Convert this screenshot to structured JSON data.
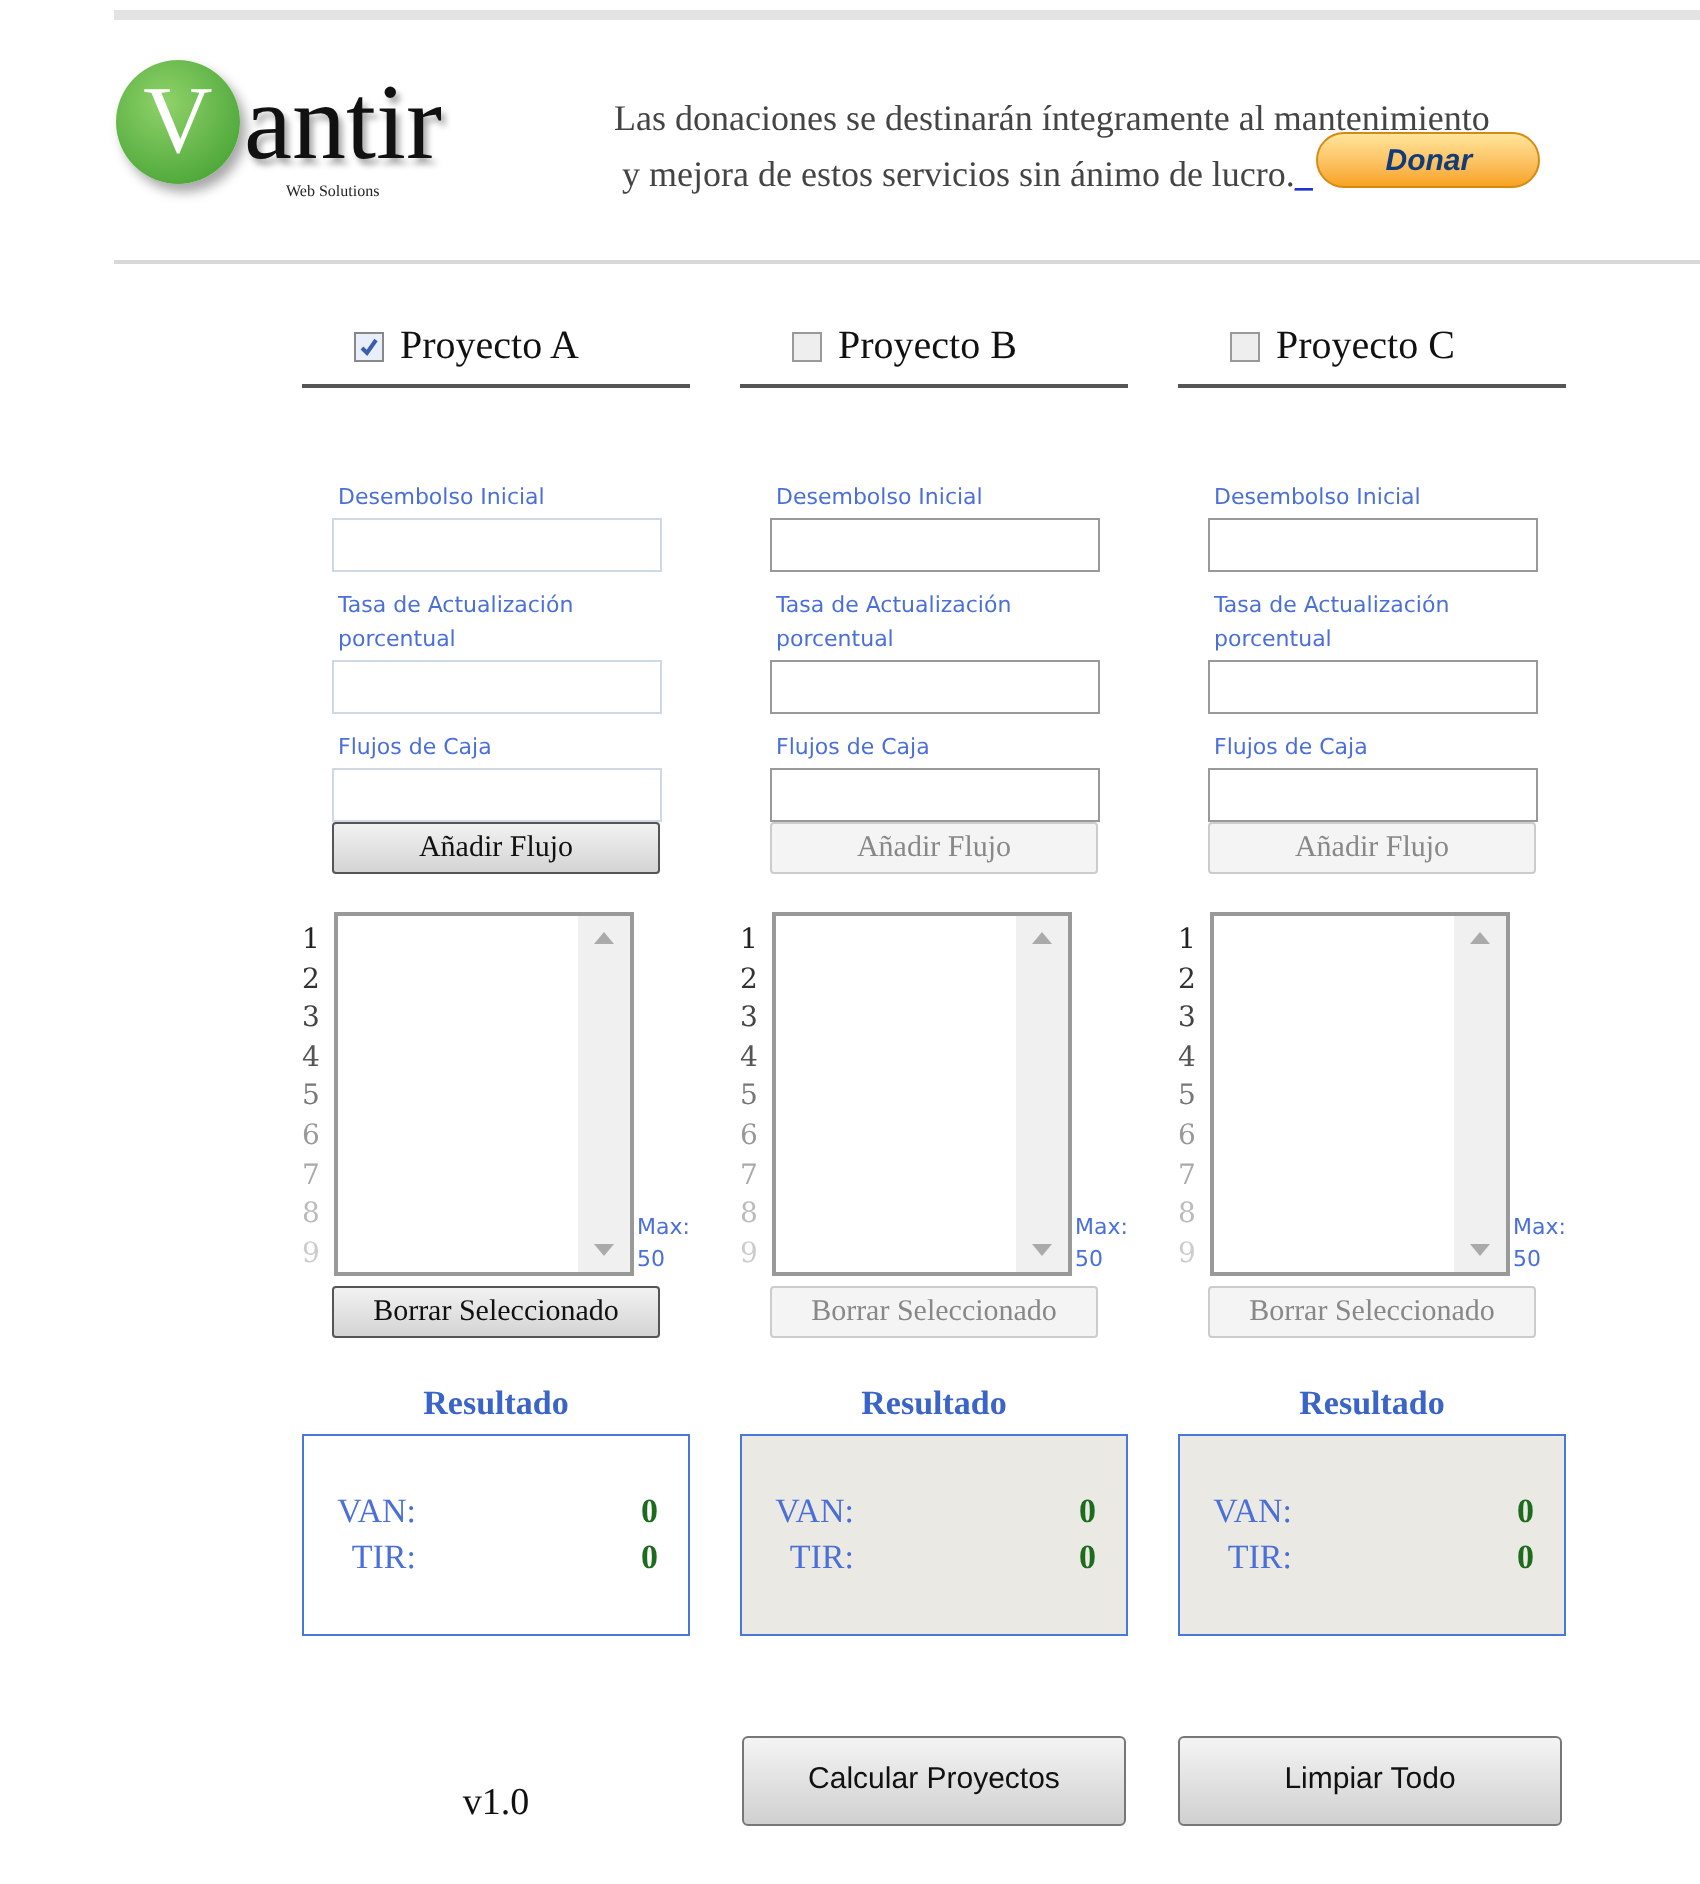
{
  "logo": {
    "letter": "V",
    "name": "antir",
    "tagline": "Web Solutions"
  },
  "donation": {
    "line_1": "Las donaciones se destinarán íntegramente al mantenimiento",
    "line_2": "y mejora de estos servicios sin ánimo de lucro.",
    "link": "_",
    "button": "Donar"
  },
  "projects": [
    {
      "title": "Proyecto A",
      "checked": true,
      "fields": [
        {
          "label": "Desembolso Inicial"
        },
        {
          "label": "Tasa de Actualización porcentual"
        },
        {
          "label": "Flujos de Caja"
        }
      ],
      "add_button": "Añadir Flujo",
      "line_numbers": [
        "1",
        "2",
        "3",
        "4",
        "5",
        "6",
        "7",
        "8",
        "9"
      ],
      "max_label": "Max:",
      "max_value": "50",
      "delete_button": "Borrar Seleccionado",
      "result_title": "Resultado",
      "results": [
        {
          "label": "VAN:",
          "value": "0"
        },
        {
          "label": "TIR:",
          "value": "0"
        }
      ]
    },
    {
      "title": "Proyecto B",
      "checked": false,
      "fields": [
        {
          "label": "Desembolso Inicial"
        },
        {
          "label": "Tasa de Actualización porcentual"
        },
        {
          "label": "Flujos de Caja"
        }
      ],
      "add_button": "Añadir Flujo",
      "line_numbers": [
        "1",
        "2",
        "3",
        "4",
        "5",
        "6",
        "7",
        "8",
        "9"
      ],
      "max_label": "Max:",
      "max_value": "50",
      "delete_button": "Borrar Seleccionado",
      "result_title": "Resultado",
      "results": [
        {
          "label": "VAN:",
          "value": "0"
        },
        {
          "label": "TIR:",
          "value": "0"
        }
      ]
    },
    {
      "title": "Proyecto C",
      "checked": false,
      "fields": [
        {
          "label": "Desembolso Inicial"
        },
        {
          "label": "Tasa de Actualización porcentual"
        },
        {
          "label": "Flujos de Caja"
        }
      ],
      "add_button": "Añadir Flujo",
      "line_numbers": [
        "1",
        "2",
        "3",
        "4",
        "5",
        "6",
        "7",
        "8",
        "9"
      ],
      "max_label": "Max:",
      "max_value": "50",
      "delete_button": "Borrar Seleccionado",
      "result_title": "Resultado",
      "results": [
        {
          "label": "VAN:",
          "value": "0"
        },
        {
          "label": "TIR:",
          "value": "0"
        }
      ]
    }
  ],
  "version": "v1.0",
  "buttons": [
    "Calcular Proyectos",
    "Limpiar Todo"
  ]
}
